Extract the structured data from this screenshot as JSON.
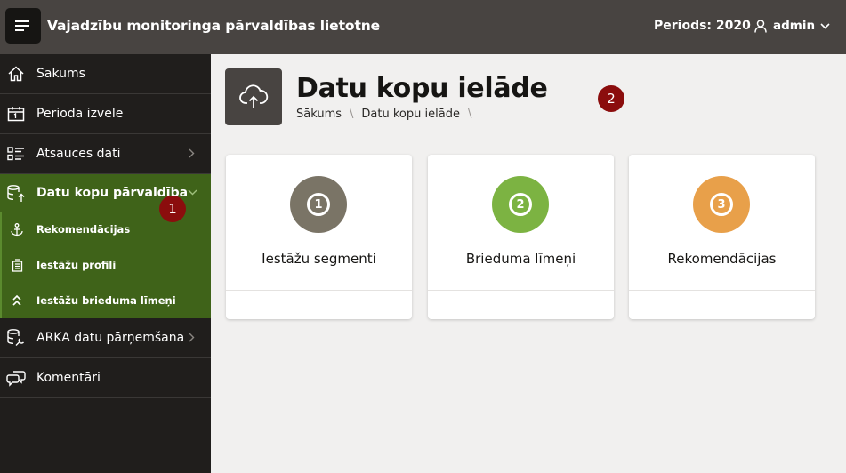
{
  "header": {
    "app_title": "Vajadzību monitoringa pārvaldības lietotne",
    "period": "Periods: 2020",
    "user": "admin"
  },
  "sidebar": {
    "items": [
      {
        "label": "Sākums",
        "icon": "home-icon"
      },
      {
        "label": "Perioda izvēle",
        "icon": "calendar-icon"
      },
      {
        "label": "Atsauces dati",
        "icon": "list-icon",
        "has_children": true
      },
      {
        "label": "Datu kopu pārvaldība",
        "icon": "database-upload-icon",
        "expanded": true,
        "active": true,
        "children": [
          {
            "label": "Rekomendācijas",
            "icon": "anchor-icon"
          },
          {
            "label": "Iestāžu profili",
            "icon": "building-icon"
          },
          {
            "label": "Iestāžu brieduma līmeņi",
            "icon": "double-chevron-up-icon"
          }
        ]
      },
      {
        "label": "ARKA datu pārņemšana",
        "icon": "database-wrench-icon",
        "has_children": true
      },
      {
        "label": "Komentāri",
        "icon": "comments-icon"
      }
    ]
  },
  "annotations": [
    "1",
    "2"
  ],
  "page": {
    "title": "Datu kopu ielāde",
    "breadcrumb": [
      "Sākums",
      "Datu kopu ielāde"
    ],
    "icon": "cloud-upload-icon"
  },
  "cards": [
    {
      "number": "1",
      "title": "Iestāžu segmenti",
      "color": "#7a7466"
    },
    {
      "number": "2",
      "title": "Brieduma līmeņi",
      "color": "#7cb342"
    },
    {
      "number": "3",
      "title": "Rekomendācijas",
      "color": "#e8a04a"
    }
  ],
  "colors": {
    "header_bg": "#484441",
    "sidebar_bg": "#201e1c",
    "active_nav": "#3f6319",
    "badge": "#8b0d0d"
  }
}
